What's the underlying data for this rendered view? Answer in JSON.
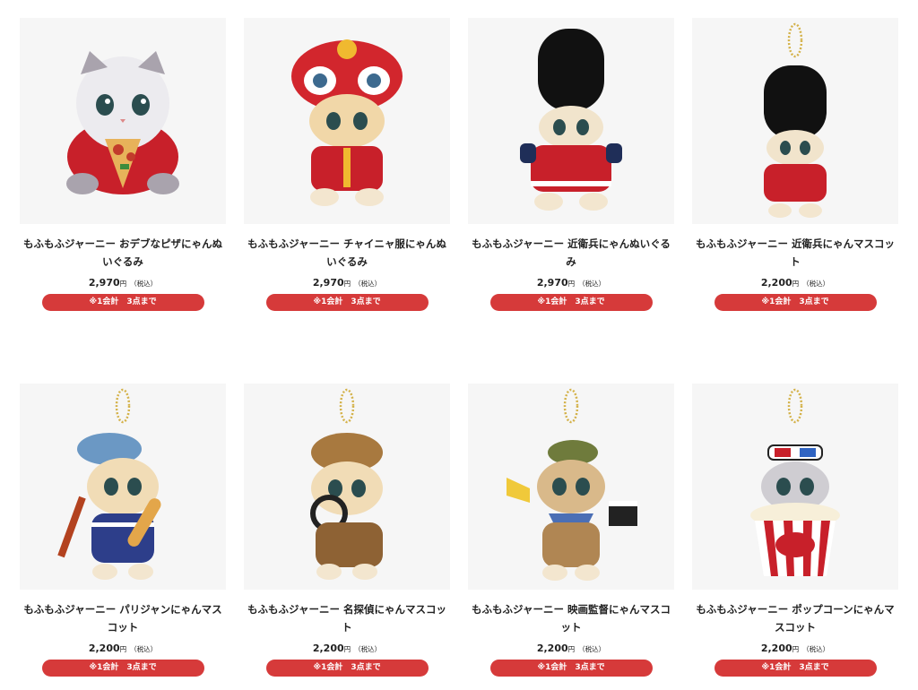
{
  "products": [
    {
      "name": "もふもふジャーニー おデブなピザにゃんぬいぐるみ",
      "price": "2,970",
      "unit": "円",
      "tax": "（税込）",
      "limit": "※1会計　3点まで",
      "icon": "pizza-cat-plush-icon"
    },
    {
      "name": "もふもふジャーニー チャイニャ服にゃんぬいぐるみ",
      "price": "2,970",
      "unit": "円",
      "tax": "（税込）",
      "limit": "※1会計　3点まで",
      "icon": "lion-dance-cat-plush-icon"
    },
    {
      "name": "もふもふジャーニー 近衛兵にゃんぬいぐるみ",
      "price": "2,970",
      "unit": "円",
      "tax": "（税込）",
      "limit": "※1会計　3点まで",
      "icon": "guard-cat-plush-icon"
    },
    {
      "name": "もふもふジャーニー 近衛兵にゃんマスコット",
      "price": "2,200",
      "unit": "円",
      "tax": "（税込）",
      "limit": "※1会計　3点まで",
      "icon": "guard-cat-mascot-icon"
    },
    {
      "name": "もふもふジャーニー パリジャンにゃんマスコット",
      "price": "2,200",
      "unit": "円",
      "tax": "（税込）",
      "limit": "※1会計　3点まで",
      "icon": "parisian-cat-mascot-icon"
    },
    {
      "name": "もふもふジャーニー 名探偵にゃんマスコット",
      "price": "2,200",
      "unit": "円",
      "tax": "（税込）",
      "limit": "※1会計　3点まで",
      "icon": "detective-cat-mascot-icon"
    },
    {
      "name": "もふもふジャーニー 映画監督にゃんマスコット",
      "price": "2,200",
      "unit": "円",
      "tax": "（税込）",
      "limit": "※1会計　3点まで",
      "icon": "director-cat-mascot-icon"
    },
    {
      "name": "もふもふジャーニー ポップコーンにゃんマスコット",
      "price": "2,200",
      "unit": "円",
      "tax": "（税込）",
      "limit": "※1会計　3点まで",
      "icon": "popcorn-cat-mascot-icon"
    }
  ],
  "colors": {
    "limit_button": "#d63a3a",
    "thumb_bg": "#f6f6f6"
  }
}
